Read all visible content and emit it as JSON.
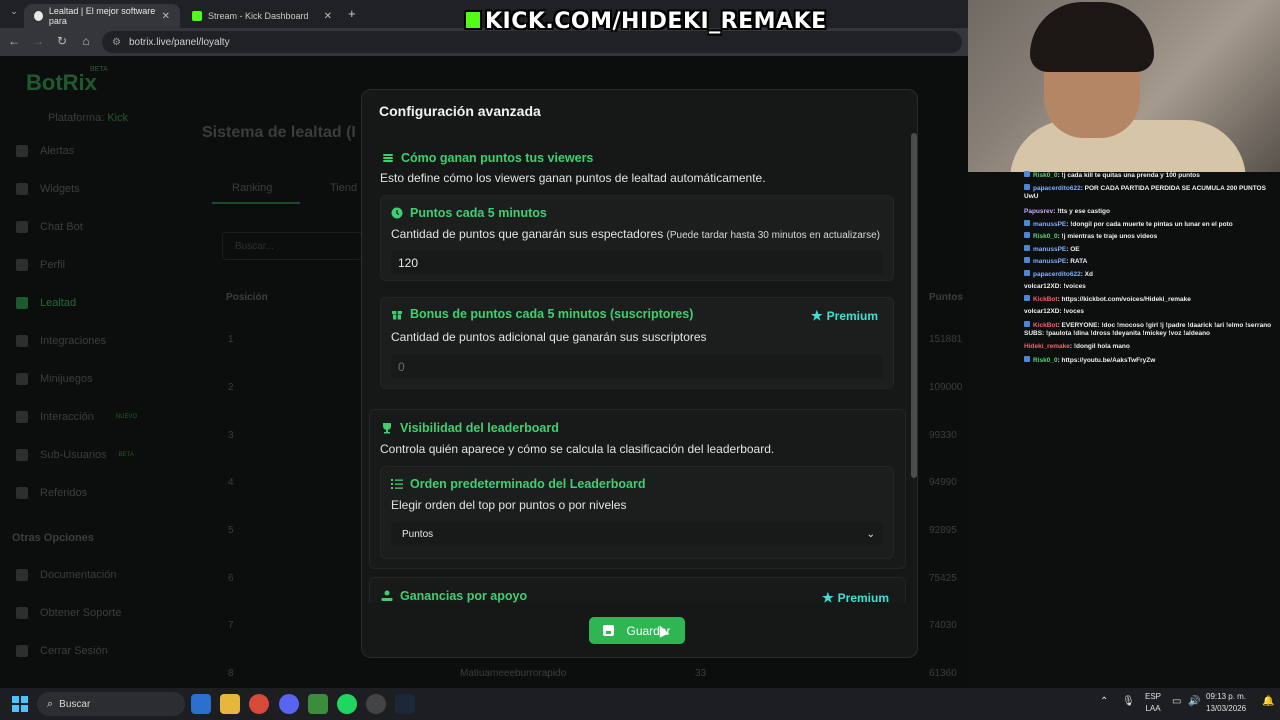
{
  "browser": {
    "tabs": [
      {
        "label": "Lealtad | El mejor software para"
      },
      {
        "label": "Stream - Kick Dashboard"
      }
    ],
    "new_tab": "+",
    "url": "botrix.live/panel/loyalty"
  },
  "stream_overlay": {
    "banner": "KICK.COM/HIDEKI_REMAKE"
  },
  "background_page": {
    "logo": "BotRix",
    "logo_badge": "BETA",
    "platform_label": "Plataforma:",
    "platform_value": "Kick",
    "sidebar": [
      {
        "label": "Alertas"
      },
      {
        "label": "Widgets"
      },
      {
        "label": "Chat Bot"
      },
      {
        "label": "Perfil"
      },
      {
        "label": "Lealtad"
      },
      {
        "label": "Integraciones"
      },
      {
        "label": "Minijuegos"
      },
      {
        "label": "Interacción"
      },
      {
        "label": "Sub-Usuarios"
      },
      {
        "label": "Referidos"
      }
    ],
    "interaccion_badge": "NUEVO",
    "subusuarios_badge": "BETA",
    "otras_opciones": "Otras Opciones",
    "sidebar_bottom": [
      {
        "label": "Documentación"
      },
      {
        "label": "Obtener Soporte"
      },
      {
        "label": "Cerrar Sesión"
      }
    ],
    "title": "Sistema de lealtad (I",
    "tabs": [
      "Ranking",
      "Tiend"
    ],
    "search_placeholder": "Buscar...",
    "col_position": "Posición",
    "col_points": "Puntos",
    "ranks": [
      "1",
      "2",
      "3",
      "4",
      "5",
      "6",
      "7",
      "8"
    ],
    "points": [
      "151881",
      "109000",
      "99330",
      "94990",
      "92895",
      "75425",
      "74030",
      "61360"
    ],
    "row8_user": "Matiuameeeburrorapido",
    "row8_level": "33"
  },
  "modal": {
    "title": "Configuración avanzada",
    "sections": {
      "earn": {
        "heading": "Cómo ganan puntos tus viewers",
        "description": "Esto define cómo los viewers ganan puntos de lealtad automáticamente.",
        "points_every": {
          "heading": "Puntos cada 5 minutos",
          "description": "Cantidad de puntos que ganarán sus espectadores",
          "note": "(Puede tardar hasta 30 minutos en actualizarse)",
          "value": "120"
        },
        "sub_bonus": {
          "heading": "Bonus de puntos cada 5 minutos (suscriptores)",
          "premium": "Premium",
          "description": "Cantidad de puntos adicional que ganarán sus suscriptores",
          "value": "0"
        }
      },
      "leaderboard": {
        "heading": "Visibilidad del leaderboard",
        "description": "Controla quién aparece y cómo se calcula la clasificación del leaderboard.",
        "order": {
          "heading": "Orden predeterminado del Leaderboard",
          "description": "Elegir orden del top por puntos o por niveles",
          "selected": "Puntos"
        }
      },
      "support": {
        "heading": "Ganancias por apoyo",
        "premium": "Premium"
      }
    },
    "save_label": "Guardar"
  },
  "chat": [
    {
      "user": "Risk0_0",
      "msg": ": !j cada kill te quitas una prenda y 100 puntos"
    },
    {
      "user": "papacerdito622",
      "msg": ": POR CADA PARTIDA PERDIDA SE ACUMULA 200 PUNTOS UwU"
    },
    {
      "user": "Papusrev",
      "msg": ": !tts y ese castigo"
    },
    {
      "user": "manussPE",
      "msg": ": !dongil por cada muerte te pintas un lunar en el poto"
    },
    {
      "user": "Risk0_0",
      "msg": ": !j mientras te traje unos videos"
    },
    {
      "user": "manussPE",
      "msg": ": OE"
    },
    {
      "user": "manussPE",
      "msg": ": RATA"
    },
    {
      "user": "papacerdito622",
      "msg": ": Xd"
    },
    {
      "user": "volcar12XD",
      "msg": ": !voices"
    },
    {
      "user": "KickBot",
      "msg": ": https://kickbot.com/voices/Hideki_remake"
    },
    {
      "user": "volcar12XD",
      "msg": ": !voces"
    },
    {
      "user": "KickBot",
      "msg": ": EVERYONE: !doc !mocoso !girl !j !padre !daarick !ari !elmo !serrano SUBS: !paulota !dina !dross !deyanita !mickey !voz !aldeano"
    },
    {
      "user": "Hideki_remake",
      "msg": ": !dongil hola mano"
    },
    {
      "user": "Risk0_0",
      "msg": ": https://youtu.be/AaksTwFryZw"
    }
  ],
  "taskbar": {
    "search_label": "Buscar",
    "lang_top": "ESP",
    "lang_bottom": "LAA",
    "time": "09:13 p. m.",
    "date": "13/03/2026"
  },
  "colors": {
    "accent_green": "#3ed070",
    "premium_cyan": "#3ee0d6",
    "save_button": "#2fb552"
  }
}
